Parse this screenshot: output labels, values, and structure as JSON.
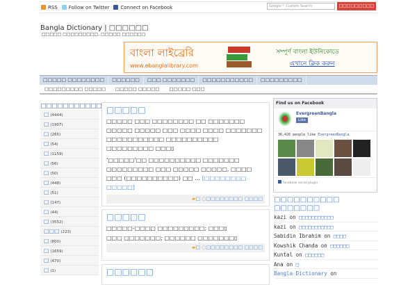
{
  "topbar": {
    "rss": "RSS",
    "twitter": "Follow on Twitter",
    "facebook": "Connect on Facebook",
    "search_placeholder": "Google™ Custom Search",
    "search_button": "□□□□□□□□□"
  },
  "header": {
    "title": "Bangla Dictionary | □□□□□□",
    "tagline": "□□□□□ □□□□□□□□□, □□□□□ □□□□□□"
  },
  "banner": {
    "left_title": "বাংলা লাইব্রেরি",
    "url": "www.ebanglalibrary.com",
    "right_title": "সম্পূর্ণ বাংলা ইউনিকোডে",
    "cta": "এখানে ক্লিক করুন"
  },
  "nav": {
    "primary": [
      "□□□□□ □□□□□□□□",
      "□□□□□□",
      "□□□ □□□□□□□",
      "□□□□□□□□□□□",
      "□□□□□□□□□"
    ],
    "secondary": [
      "□□□□□□□□□ □□□□□",
      "□□□□□ □□□□□",
      "□□□□□ □□□"
    ]
  },
  "categories": {
    "heading": "□□□□□□□□□□□□□",
    "items": [
      {
        "n": "□",
        "c": "(4444)"
      },
      {
        "n": "□",
        "c": "(1907)"
      },
      {
        "n": "□",
        "c": "(265)"
      },
      {
        "n": "□",
        "c": "(54)"
      },
      {
        "n": "□",
        "c": "(1159)"
      },
      {
        "n": "□",
        "c": "(56)"
      },
      {
        "n": "□",
        "c": "(50)"
      },
      {
        "n": "□",
        "c": "(448)"
      },
      {
        "n": "□",
        "c": "(51)"
      },
      {
        "n": "□",
        "c": "(147)"
      },
      {
        "n": "□",
        "c": "(44)"
      },
      {
        "n": "□",
        "c": "(3552)"
      },
      {
        "n": "□□□",
        "c": "(223)"
      },
      {
        "n": "□",
        "c": "(800)"
      },
      {
        "n": "□",
        "c": "(1659)"
      },
      {
        "n": "□",
        "c": "(470)"
      },
      {
        "n": "□",
        "c": "(1)"
      }
    ]
  },
  "posts": [
    {
      "title": "□□□□□",
      "paras": [
        "□□□□□ □□□ □□□□□□□□ □□ □□□□□□□ □□□□□ □□□□□ □□□ □□□□ □□□□ □□□□□□□ □□□□□□□□□□□ □□□□□□□□□□ □□□□□□□□□ □□□▯",
        "‘□□□□□’□□ □□□□□□□□□□ □□□□□□□ □□□□□□□□□ □□□ □□□□□ □□□□□, □□□□ □□□ (□□□□□□□□□□) □□ …"
      ],
      "more": "[□□□□□□□□ □□□□□]",
      "cat": "□",
      "comments": "□□□□□□□□ □□□□"
    },
    {
      "title": "□□□□□",
      "paras": [
        "□□□□□-□□□□ □□□□□□□□□; □□□▯",
        "□□□ □□□□□□□; □□□□□□ □□□□□□□▯"
      ],
      "cat": "□",
      "comments": "□□□□□□□□ □□□□"
    },
    {
      "title": "□□□□□□"
    }
  ],
  "facebook": {
    "header": "Find us on Facebook",
    "page": "EvergreenBangla",
    "like": "Like",
    "count_text": "36,426 people like",
    "count_link": "EvergreenBangla.",
    "plugin": "Facebook social plugin"
  },
  "recent": {
    "heading": "□□□□□□□□□□ □□□□□□□",
    "on": "on",
    "items": [
      {
        "a": "kazi",
        "p": "□□□□□□□□□□□"
      },
      {
        "a": "kazi",
        "p": "□□□□□□□□□□□"
      },
      {
        "a": "Sabidin Ibrahim",
        "p": "□□□□"
      },
      {
        "a": "Kowshik Chanda",
        "p": "□□□□□□"
      },
      {
        "a": "Kuntal",
        "p": "□□□□□□"
      },
      {
        "a": "Ana",
        "p": "□"
      },
      {
        "a": "Bangla Dictionary",
        "p": ""
      }
    ]
  }
}
